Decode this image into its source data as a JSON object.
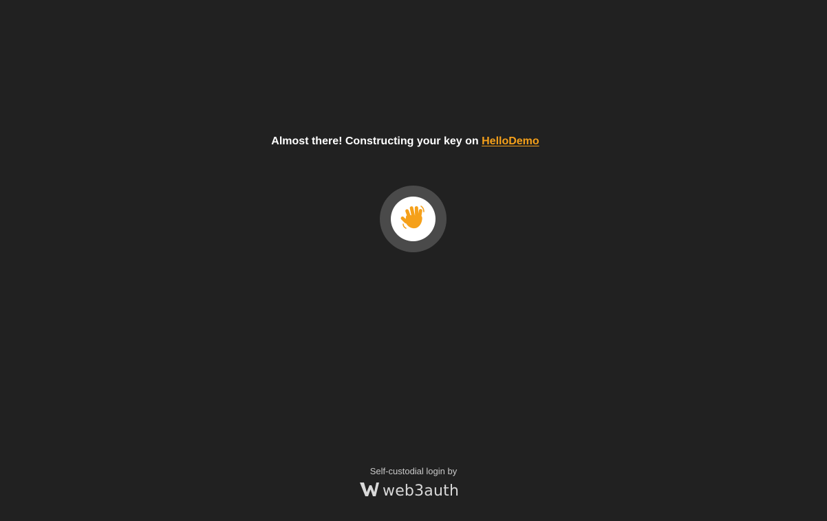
{
  "heading": {
    "prefix": "Almost there! Constructing your key on ",
    "app_link": "HelloDemo"
  },
  "loader": {
    "icon": "waving-hand-icon",
    "accent_color": "#f5a01a"
  },
  "footer": {
    "label": "Self-custodial login by",
    "brand_name": "web3auth",
    "brand_icon": "web3auth-logo-icon"
  },
  "colors": {
    "background": "#212121",
    "accent": "#f5a01a",
    "text": "#ffffff"
  }
}
